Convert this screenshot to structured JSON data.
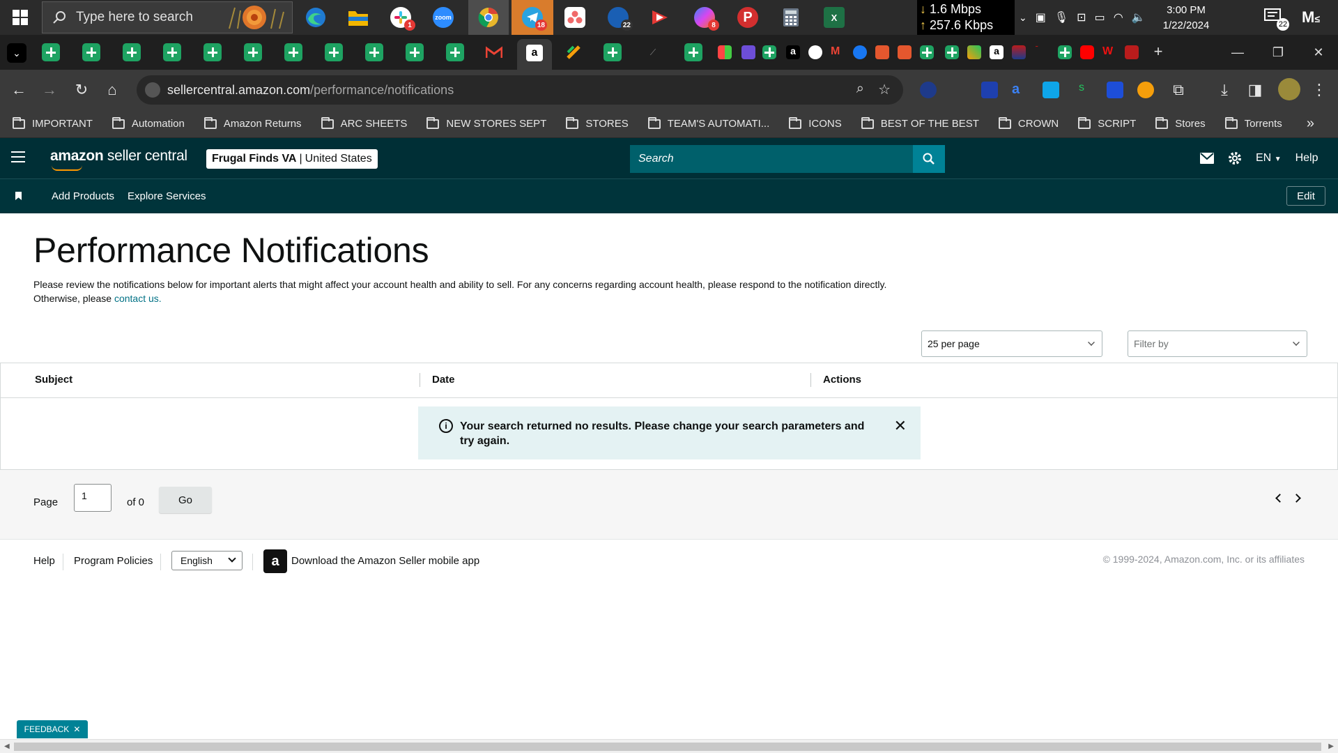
{
  "taskbar": {
    "search_placeholder": "Type here to search",
    "apps": [
      {
        "name": "edge",
        "color": "#1f7ad1"
      },
      {
        "name": "file-explorer",
        "color": "#f2b600"
      },
      {
        "name": "slack",
        "color": "#ffffff",
        "badge": "1"
      },
      {
        "name": "zoom",
        "color": "#2d8cff",
        "label": "zoom"
      },
      {
        "name": "chrome",
        "color": "#e8b62b"
      },
      {
        "name": "telegram",
        "color": "#2aa3e0",
        "badge": "18"
      },
      {
        "name": "asana",
        "color": "#f06a6a"
      },
      {
        "name": "messenger-app",
        "color": "#1a5fb4",
        "badge": "22"
      },
      {
        "name": "infinity-red",
        "color": "#e53935"
      },
      {
        "name": "messenger",
        "color": "#b444d9",
        "badge": "8"
      },
      {
        "name": "pushbullet",
        "color": "#d32f2f",
        "label": "P"
      },
      {
        "name": "calculator",
        "color": "#6d7a8a"
      },
      {
        "name": "excel",
        "color": "#1e7145",
        "label": "X"
      }
    ],
    "net_down": "1.6 Mbps",
    "net_up": "257.6 Kbps",
    "time": "3:00 PM",
    "date": "1/22/2024",
    "notification_count": "22",
    "user_initial": "M"
  },
  "browser": {
    "url_host": "sellercentral.amazon.com",
    "url_path": "/performance/notifications",
    "bookmarks": [
      "IMPORTANT",
      "Automation",
      "Amazon Returns",
      "ARC SHEETS",
      "NEW STORES SEPT",
      "STORES",
      "TEAM'S AUTOMATI...",
      "ICONS",
      "BEST OF THE BEST",
      "CROWN",
      "SCRIPT",
      "Stores",
      "Torrents"
    ]
  },
  "header": {
    "logo_bold": "amazon",
    "logo_rest": " seller central",
    "store_name": "Frugal Finds VA",
    "store_sep": " | ",
    "store_region": "United States",
    "search_placeholder": "Search",
    "lang": "EN",
    "help": "Help"
  },
  "subnav": {
    "links": [
      "Add Products",
      "Explore Services"
    ],
    "edit": "Edit"
  },
  "page": {
    "title": "Performance Notifications",
    "desc_text": "Please review the notifications below for important alerts that might affect your account health and ability to sell. For any concerns regarding account health, please respond to the notification directly. Otherwise, please ",
    "desc_link": "contact us.",
    "per_page": "25 per page",
    "filter_placeholder": "Filter by"
  },
  "table": {
    "columns": [
      "Subject",
      "Date",
      "Actions"
    ],
    "empty_message": "Your search returned no results. Please change your search parameters and try again."
  },
  "pager": {
    "page_label": "Page",
    "page_value": "1",
    "of_label": "of 0",
    "go": "Go"
  },
  "footer": {
    "help": "Help",
    "policies": "Program Policies",
    "language": "English",
    "app_text": "Download the Amazon Seller mobile app",
    "copyright": "© 1999-2024, Amazon.com, Inc. or its affiliates"
  },
  "feedback": "FEEDBACK"
}
